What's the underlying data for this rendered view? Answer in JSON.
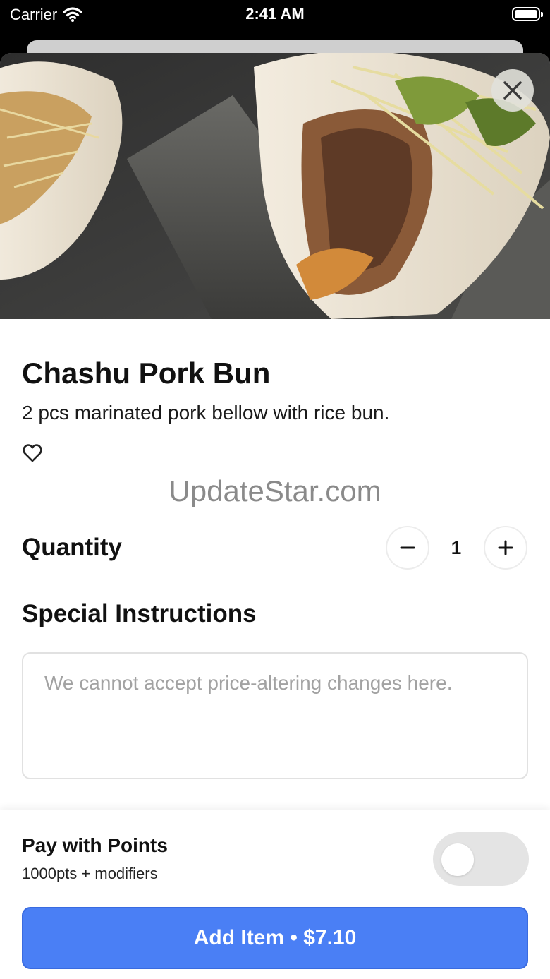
{
  "status_bar": {
    "carrier": "Carrier",
    "time": "2:41 AM",
    "wifi_icon": "wifi-icon",
    "battery_icon": "battery-icon"
  },
  "hero": {
    "image": "food-photo-chashu-pork-buns"
  },
  "close": {
    "icon": "close-icon"
  },
  "item": {
    "title": "Chashu Pork Bun",
    "description": "2 pcs marinated pork bellow with rice bun.",
    "favorite_icon": "heart-outline-icon"
  },
  "watermark": "UpdateStar.com",
  "quantity": {
    "label": "Quantity",
    "value": "1",
    "minus_icon": "minus-icon",
    "plus_icon": "plus-icon"
  },
  "special_instructions": {
    "label": "Special Instructions",
    "value": "",
    "placeholder": "We cannot accept price-altering changes here."
  },
  "pay_with_points": {
    "label": "Pay with Points",
    "subtitle": "1000pts + modifiers",
    "enabled": false
  },
  "add_button": {
    "label": "Add Item • $7.10"
  },
  "colors": {
    "accent": "#4a7ff5",
    "toggle_off": "#e4e4e4",
    "close_bg": "#e1e1da"
  }
}
